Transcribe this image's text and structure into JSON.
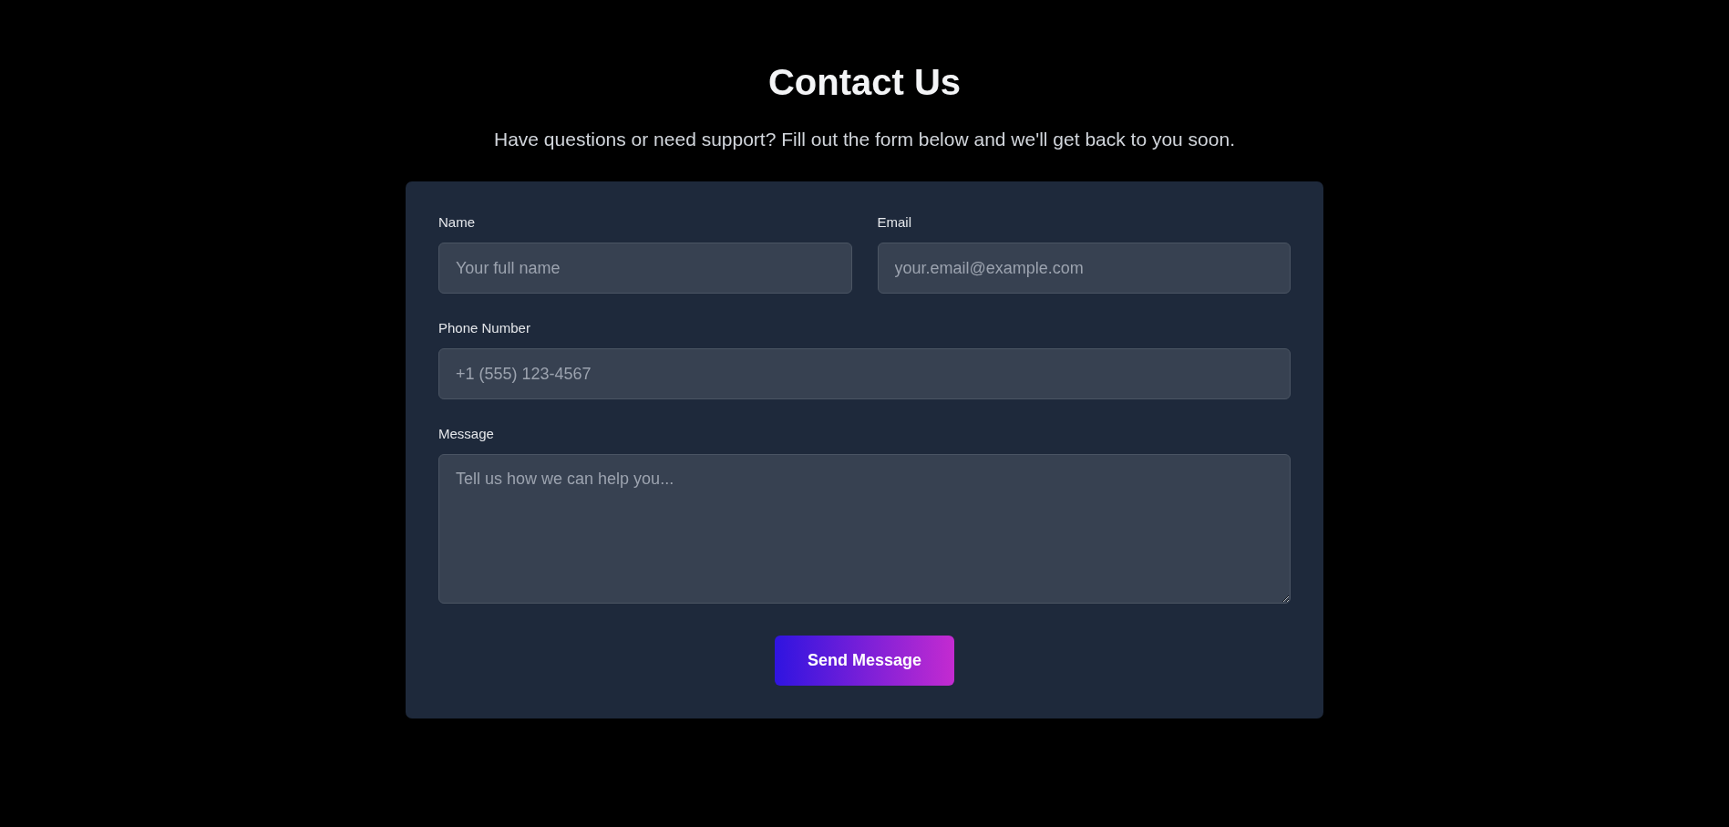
{
  "title": "Contact Us",
  "subtitle": "Have questions or need support? Fill out the form below and we'll get back to you soon.",
  "fields": [
    {
      "kind": "input",
      "label": "Name",
      "placeholder": "Your full name"
    },
    {
      "kind": "input",
      "label": "Email",
      "placeholder": "your.email@example.com"
    },
    {
      "kind": "input",
      "label": "Phone Number",
      "placeholder": "+1 (555) 123-4567"
    },
    {
      "kind": "textarea",
      "label": "Message",
      "placeholder": "Tell us how we can help you..."
    }
  ],
  "submit": "Send Message"
}
